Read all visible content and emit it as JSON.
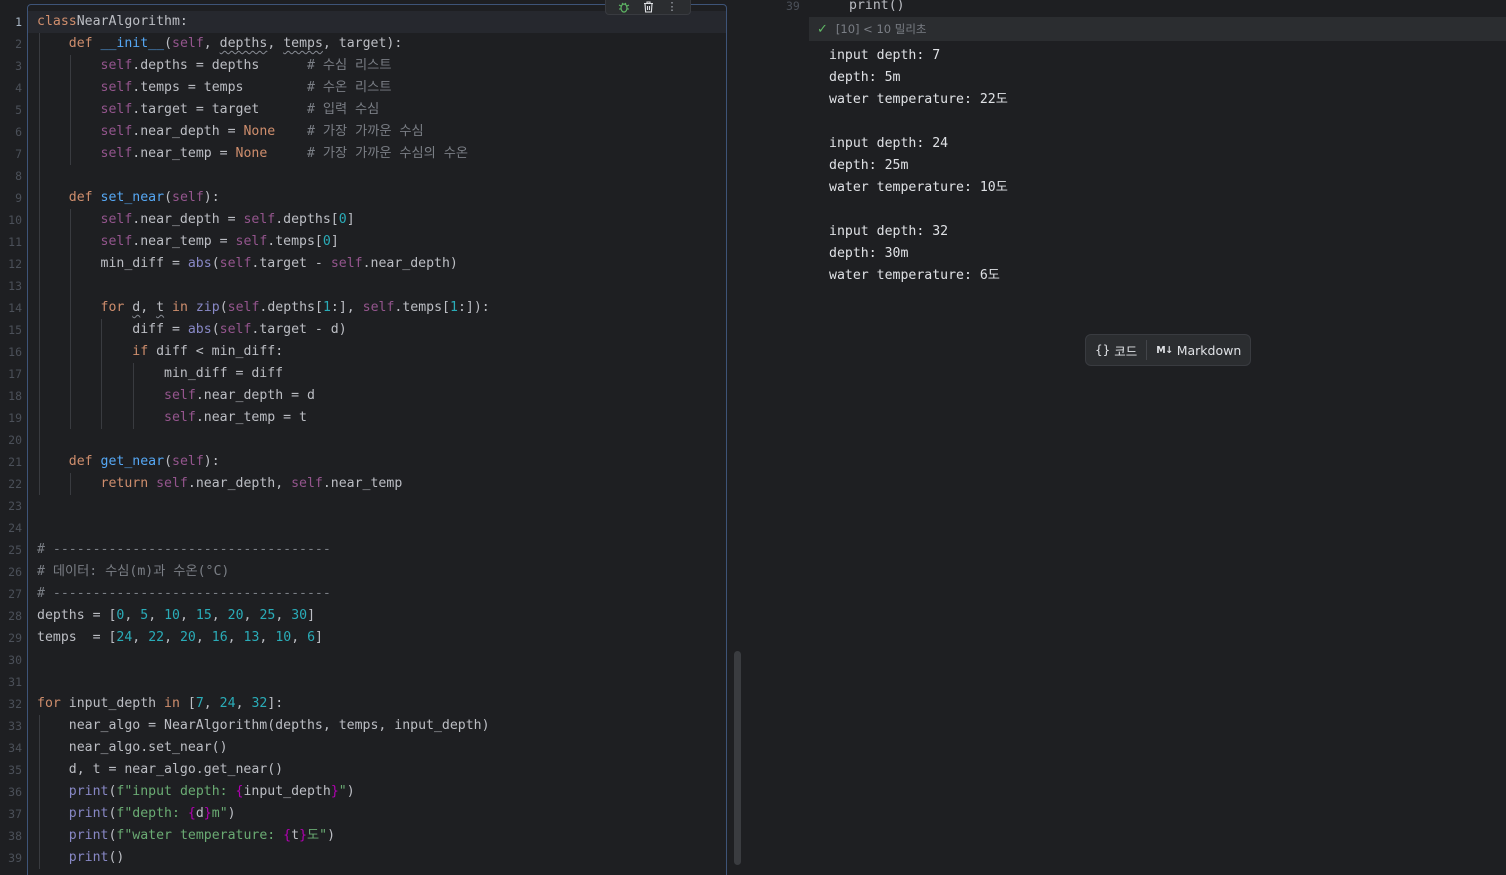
{
  "editor": {
    "current_line": 1,
    "toolbar": {
      "debug_icon": "bug-icon",
      "delete_icon": "trash-icon",
      "more_icon": "more-vertical-icon"
    },
    "lines": [
      [
        [
          "kw",
          "class"
        ],
        [
          "",
          "NearAlgorithm:"
        ]
      ],
      [
        [
          "",
          "    "
        ],
        [
          "kw",
          "def "
        ],
        [
          "fn",
          "__init__"
        ],
        [
          "",
          "("
        ],
        [
          "sf",
          "self"
        ],
        [
          "",
          ", "
        ],
        [
          "squig",
          "depths"
        ],
        [
          "",
          ", "
        ],
        [
          "squig",
          "temps"
        ],
        [
          "",
          ", target):"
        ]
      ],
      [
        [
          "",
          "        "
        ],
        [
          "sf",
          "self"
        ],
        [
          "",
          ".depths = depths      "
        ],
        [
          "cm",
          "# 수심 리스트"
        ]
      ],
      [
        [
          "",
          "        "
        ],
        [
          "sf",
          "self"
        ],
        [
          "",
          ".temps = temps        "
        ],
        [
          "cm",
          "# 수온 리스트"
        ]
      ],
      [
        [
          "",
          "        "
        ],
        [
          "sf",
          "self"
        ],
        [
          "",
          ".target = target      "
        ],
        [
          "cm",
          "# 입력 수심"
        ]
      ],
      [
        [
          "",
          "        "
        ],
        [
          "sf",
          "self"
        ],
        [
          "",
          ".near_depth = "
        ],
        [
          "kw",
          "None"
        ],
        [
          "",
          "    "
        ],
        [
          "cm",
          "# 가장 가까운 수심"
        ]
      ],
      [
        [
          "",
          "        "
        ],
        [
          "sf",
          "self"
        ],
        [
          "",
          ".near_temp = "
        ],
        [
          "kw",
          "None"
        ],
        [
          "",
          "     "
        ],
        [
          "cm",
          "# 가장 가까운 수심의 수온"
        ]
      ],
      [],
      [
        [
          "",
          "    "
        ],
        [
          "kw",
          "def "
        ],
        [
          "fn",
          "set_near"
        ],
        [
          "",
          "("
        ],
        [
          "sf",
          "self"
        ],
        [
          "",
          "):"
        ]
      ],
      [
        [
          "",
          "        "
        ],
        [
          "sf",
          "self"
        ],
        [
          "",
          ".near_depth = "
        ],
        [
          "sf",
          "self"
        ],
        [
          "",
          ".depths["
        ],
        [
          "nm",
          "0"
        ],
        [
          "",
          "]"
        ]
      ],
      [
        [
          "",
          "        "
        ],
        [
          "sf",
          "self"
        ],
        [
          "",
          ".near_temp = "
        ],
        [
          "sf",
          "self"
        ],
        [
          "",
          ".temps["
        ],
        [
          "nm",
          "0"
        ],
        [
          "",
          "]"
        ]
      ],
      [
        [
          "",
          "        min_diff = "
        ],
        [
          "bi",
          "abs"
        ],
        [
          "",
          "("
        ],
        [
          "sf",
          "self"
        ],
        [
          "",
          ".target - "
        ],
        [
          "sf",
          "self"
        ],
        [
          "",
          ".near_depth)"
        ]
      ],
      [],
      [
        [
          "",
          "        "
        ],
        [
          "kw",
          "for "
        ],
        [
          "squig",
          "d"
        ],
        [
          "",
          ", "
        ],
        [
          "squig",
          "t"
        ],
        [
          "kw",
          " in "
        ],
        [
          "bi",
          "zip"
        ],
        [
          "",
          "("
        ],
        [
          "sf",
          "self"
        ],
        [
          "",
          ".depths["
        ],
        [
          "nm",
          "1"
        ],
        [
          "",
          ":], "
        ],
        [
          "sf",
          "self"
        ],
        [
          "",
          ".temps["
        ],
        [
          "nm",
          "1"
        ],
        [
          "",
          ":]):"
        ]
      ],
      [
        [
          "",
          "            diff = "
        ],
        [
          "bi",
          "abs"
        ],
        [
          "",
          "("
        ],
        [
          "sf",
          "self"
        ],
        [
          "",
          ".target - d)"
        ]
      ],
      [
        [
          "",
          "            "
        ],
        [
          "kw",
          "if "
        ],
        [
          "",
          "diff < min_diff:"
        ]
      ],
      [
        [
          "",
          "                min_diff = diff"
        ]
      ],
      [
        [
          "",
          "                "
        ],
        [
          "sf",
          "self"
        ],
        [
          "",
          ".near_depth = d"
        ]
      ],
      [
        [
          "",
          "                "
        ],
        [
          "sf",
          "self"
        ],
        [
          "",
          ".near_temp = t"
        ]
      ],
      [],
      [
        [
          "",
          "    "
        ],
        [
          "kw",
          "def "
        ],
        [
          "fn",
          "get_near"
        ],
        [
          "",
          "("
        ],
        [
          "sf",
          "self"
        ],
        [
          "",
          "):"
        ]
      ],
      [
        [
          "",
          "        "
        ],
        [
          "kw",
          "return "
        ],
        [
          "sf",
          "self"
        ],
        [
          "",
          ".near_depth, "
        ],
        [
          "sf",
          "self"
        ],
        [
          "",
          ".near_temp"
        ]
      ],
      [],
      [],
      [
        [
          "cm",
          "# -----------------------------------"
        ]
      ],
      [
        [
          "cm",
          "# 데이터: 수심(m)과 수온(°C)"
        ]
      ],
      [
        [
          "cm",
          "# -----------------------------------"
        ]
      ],
      [
        [
          "",
          "depths = ["
        ],
        [
          "nm",
          "0"
        ],
        [
          "",
          ", "
        ],
        [
          "nm",
          "5"
        ],
        [
          "",
          ", "
        ],
        [
          "nm",
          "10"
        ],
        [
          "",
          ", "
        ],
        [
          "nm",
          "15"
        ],
        [
          "",
          ", "
        ],
        [
          "nm",
          "20"
        ],
        [
          "",
          ", "
        ],
        [
          "nm",
          "25"
        ],
        [
          "",
          ", "
        ],
        [
          "nm",
          "30"
        ],
        [
          "",
          "]"
        ]
      ],
      [
        [
          "",
          "temps  = ["
        ],
        [
          "nm",
          "24"
        ],
        [
          "",
          ", "
        ],
        [
          "nm",
          "22"
        ],
        [
          "",
          ", "
        ],
        [
          "nm",
          "20"
        ],
        [
          "",
          ", "
        ],
        [
          "nm",
          "16"
        ],
        [
          "",
          ", "
        ],
        [
          "nm",
          "13"
        ],
        [
          "",
          ", "
        ],
        [
          "nm",
          "10"
        ],
        [
          "",
          ", "
        ],
        [
          "nm",
          "6"
        ],
        [
          "",
          "]"
        ]
      ],
      [],
      [],
      [
        [
          "kw",
          "for "
        ],
        [
          "",
          "input_depth "
        ],
        [
          "kw",
          "in "
        ],
        [
          "",
          "["
        ],
        [
          "nm",
          "7"
        ],
        [
          "",
          ", "
        ],
        [
          "nm",
          "24"
        ],
        [
          "",
          ", "
        ],
        [
          "nm",
          "32"
        ],
        [
          "",
          "]:"
        ]
      ],
      [
        [
          "",
          "    near_algo = NearAlgorithm(depths, temps, input_depth)"
        ]
      ],
      [
        [
          "",
          "    near_algo.set_near()"
        ]
      ],
      [
        [
          "",
          "    d, t = near_algo.get_near()"
        ]
      ],
      [
        [
          "",
          "    "
        ],
        [
          "bi",
          "print"
        ],
        [
          "",
          "("
        ],
        [
          "str",
          "f\"input depth: "
        ],
        [
          "mg",
          "{"
        ],
        [
          "",
          "input_depth"
        ],
        [
          "mg",
          "}"
        ],
        [
          "str",
          "\""
        ],
        [
          "",
          ")"
        ]
      ],
      [
        [
          "",
          "    "
        ],
        [
          "bi",
          "print"
        ],
        [
          "",
          "("
        ],
        [
          "str",
          "f\"depth: "
        ],
        [
          "mg",
          "{"
        ],
        [
          "",
          "d"
        ],
        [
          "mg",
          "}"
        ],
        [
          "str",
          "m\""
        ],
        [
          "",
          ")"
        ]
      ],
      [
        [
          "",
          "    "
        ],
        [
          "bi",
          "print"
        ],
        [
          "",
          "("
        ],
        [
          "str",
          "f\"water temperature: "
        ],
        [
          "mg",
          "{"
        ],
        [
          "",
          "t"
        ],
        [
          "mg",
          "}"
        ],
        [
          "str",
          "도\""
        ],
        [
          "",
          ")"
        ]
      ],
      [
        [
          "",
          "    "
        ],
        [
          "bi",
          "print"
        ],
        [
          "",
          "()"
        ]
      ]
    ]
  },
  "output_pane": {
    "prev_line_number": "39",
    "prev_code": "print()",
    "check_icon": "check-icon",
    "exec_status": "[10] < 10 밀리초",
    "lines": [
      "input depth: 7",
      "depth: 5m",
      "water temperature: 22도",
      "",
      "input depth: 24",
      "depth: 25m",
      "water temperature: 10도",
      "",
      "input depth: 32",
      "depth: 30m",
      "water temperature: 6도"
    ],
    "add_code_label": "코드",
    "add_markdown_label": "Markdown"
  }
}
